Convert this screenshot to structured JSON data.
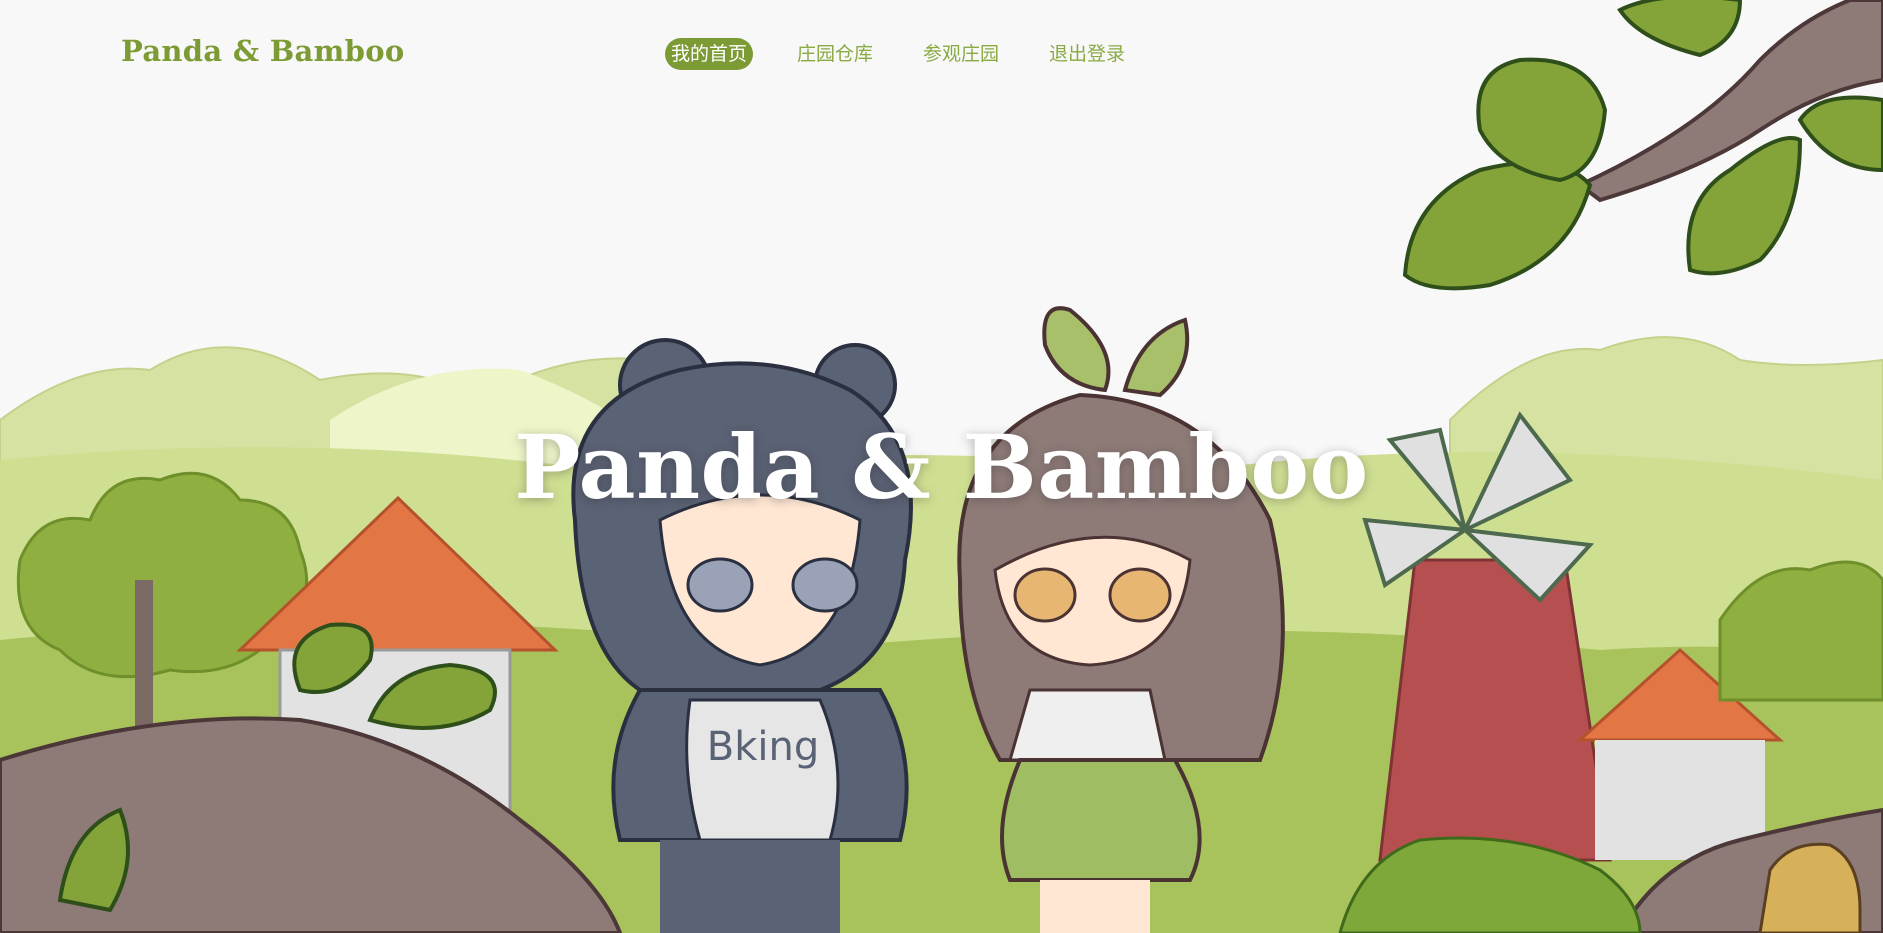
{
  "header": {
    "logo": "Panda & Bamboo",
    "nav": [
      {
        "label": "我的首页",
        "active": true
      },
      {
        "label": "庄园仓库",
        "active": false
      },
      {
        "label": "参观庄园",
        "active": false
      },
      {
        "label": "退出登录",
        "active": false
      }
    ]
  },
  "hero": {
    "title": "Panda & Bamboo",
    "shirt_text": "Bking"
  },
  "colors": {
    "accent": "#7d9b34",
    "background": "#f8f8f8"
  }
}
